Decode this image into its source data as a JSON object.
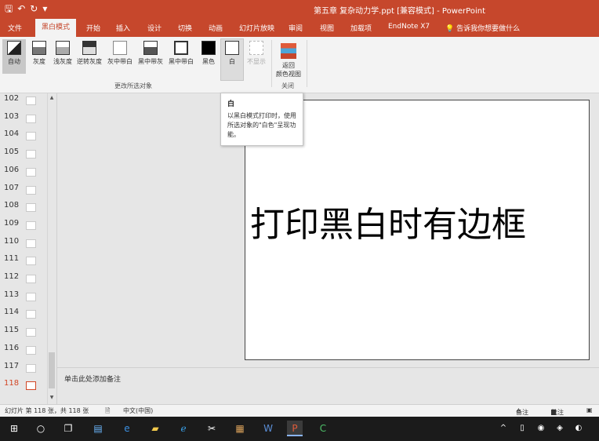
{
  "title": "第五章 复杂动力学.ppt [兼容模式]  -  PowerPoint",
  "qat": {
    "save_icon": "save-icon",
    "undo_icon": "undo-icon",
    "redo_icon": "redo-icon",
    "more": "▾"
  },
  "tabs": [
    "文件",
    "黑白模式",
    "开始",
    "插入",
    "设计",
    "切换",
    "动画",
    "幻灯片放映",
    "审阅",
    "视图",
    "加载项",
    "EndNote X7",
    "告诉我你想要做什么"
  ],
  "ribbon": {
    "buttons": [
      "自动",
      "灰度",
      "浅灰度",
      "逆转灰度",
      "灰中带白",
      "黑中带灰",
      "黑中带白",
      "黑色",
      "白",
      "不显示"
    ],
    "group_label": "更改所选对象",
    "return_button": "返回\n颜色视图",
    "return_line1": "返回",
    "return_line2": "颜色视图",
    "close_group_label": "关闭"
  },
  "thumbnails": [
    "102",
    "103",
    "104",
    "105",
    "106",
    "107",
    "108",
    "109",
    "110",
    "111",
    "112",
    "113",
    "114",
    "115",
    "116",
    "117",
    "118"
  ],
  "active_slide": "118",
  "slide": {
    "text": "打印黑白时有边框"
  },
  "tooltip": {
    "title": "白",
    "body": "以黑白模式打印时，使用所选对象的\"白色\"呈现功能。"
  },
  "notes": {
    "placeholder": "单击此处添加备注"
  },
  "status": {
    "slide_info": "幻灯片 第 118 张，共 118 张",
    "language": "中文(中国)",
    "notes": "备注",
    "comments": "批注"
  },
  "colors": {
    "accent": "#c6472c",
    "ribbon_bg": "#f3f3f3",
    "taskbar": "#1b1b1b"
  }
}
